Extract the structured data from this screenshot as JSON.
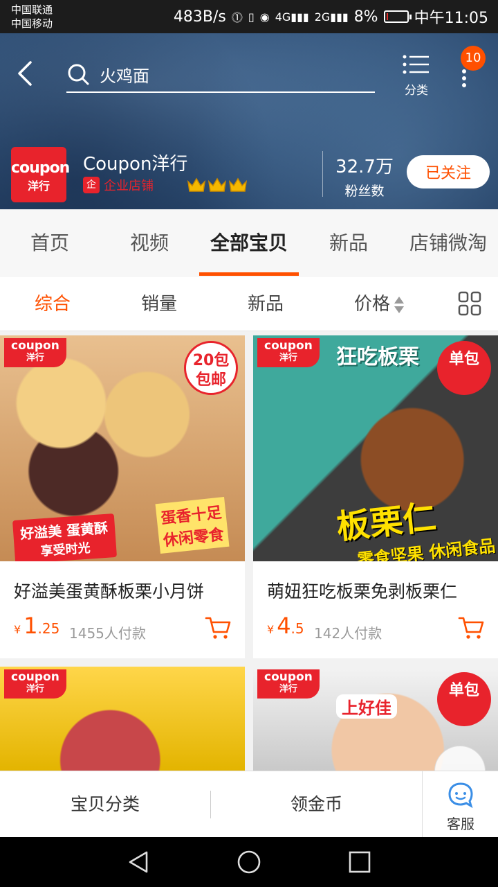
{
  "status_bar": {
    "carrier_1": "中国联通",
    "carrier_2": "中国移动",
    "net_speed": "483B/s",
    "net_4g": "4G",
    "net_2g": "2G",
    "battery": "8%",
    "battery_level": 0.08,
    "time": "中午11:05"
  },
  "header": {
    "search_value": "火鸡面",
    "category_label": "分类",
    "message_count": "10"
  },
  "shop": {
    "logo_line1": "coupon",
    "logo_line2": "洋行",
    "name": "Coupon洋行",
    "badge": "企业店铺",
    "badge_icon": "企",
    "crowns": 3,
    "fans_count": "32.7万",
    "fans_label": "粉丝数",
    "follow_label": "已关注"
  },
  "tabs": [
    "首页",
    "视频",
    "全部宝贝",
    "新品",
    "店铺微淘"
  ],
  "active_tab": 2,
  "sort": {
    "comprehensive": "综合",
    "sales": "销量",
    "new": "新品",
    "price": "价格"
  },
  "products": [
    {
      "title": "好溢美蛋黄酥板栗小月饼",
      "currency": "¥",
      "price_int": "1",
      "price_dec": ".25",
      "sold": "1455人付款",
      "tag_1": "coupon",
      "tag_2": "洋行",
      "corner": "20包\n包邮",
      "banner_1": "好溢美 蛋黄酥",
      "banner_1b": "享受时光",
      "banner_2": "蛋香十足\n休闲零食"
    },
    {
      "title": "萌妞狂吃板栗免剥板栗仁",
      "currency": "¥",
      "price_int": "4",
      "price_dec": ".5",
      "sold": "142人付款",
      "tag_1": "coupon",
      "tag_2": "洋行",
      "corner": "单包",
      "pack_title": "狂吃板栗",
      "banner_1": "板栗仁",
      "banner_2": "零食坚果 休闲食品"
    },
    {
      "tag_1": "coupon",
      "tag_2": "洋行"
    },
    {
      "tag_1": "coupon",
      "tag_2": "洋行",
      "corner": "单包",
      "pack_title": "上好佳"
    }
  ],
  "bottom_bar": {
    "category": "宝贝分类",
    "coins": "领金币",
    "service": "客服"
  },
  "colors": {
    "accent": "#ff5000",
    "brand_red": "#e8232c",
    "header_blue": "#35567d"
  }
}
